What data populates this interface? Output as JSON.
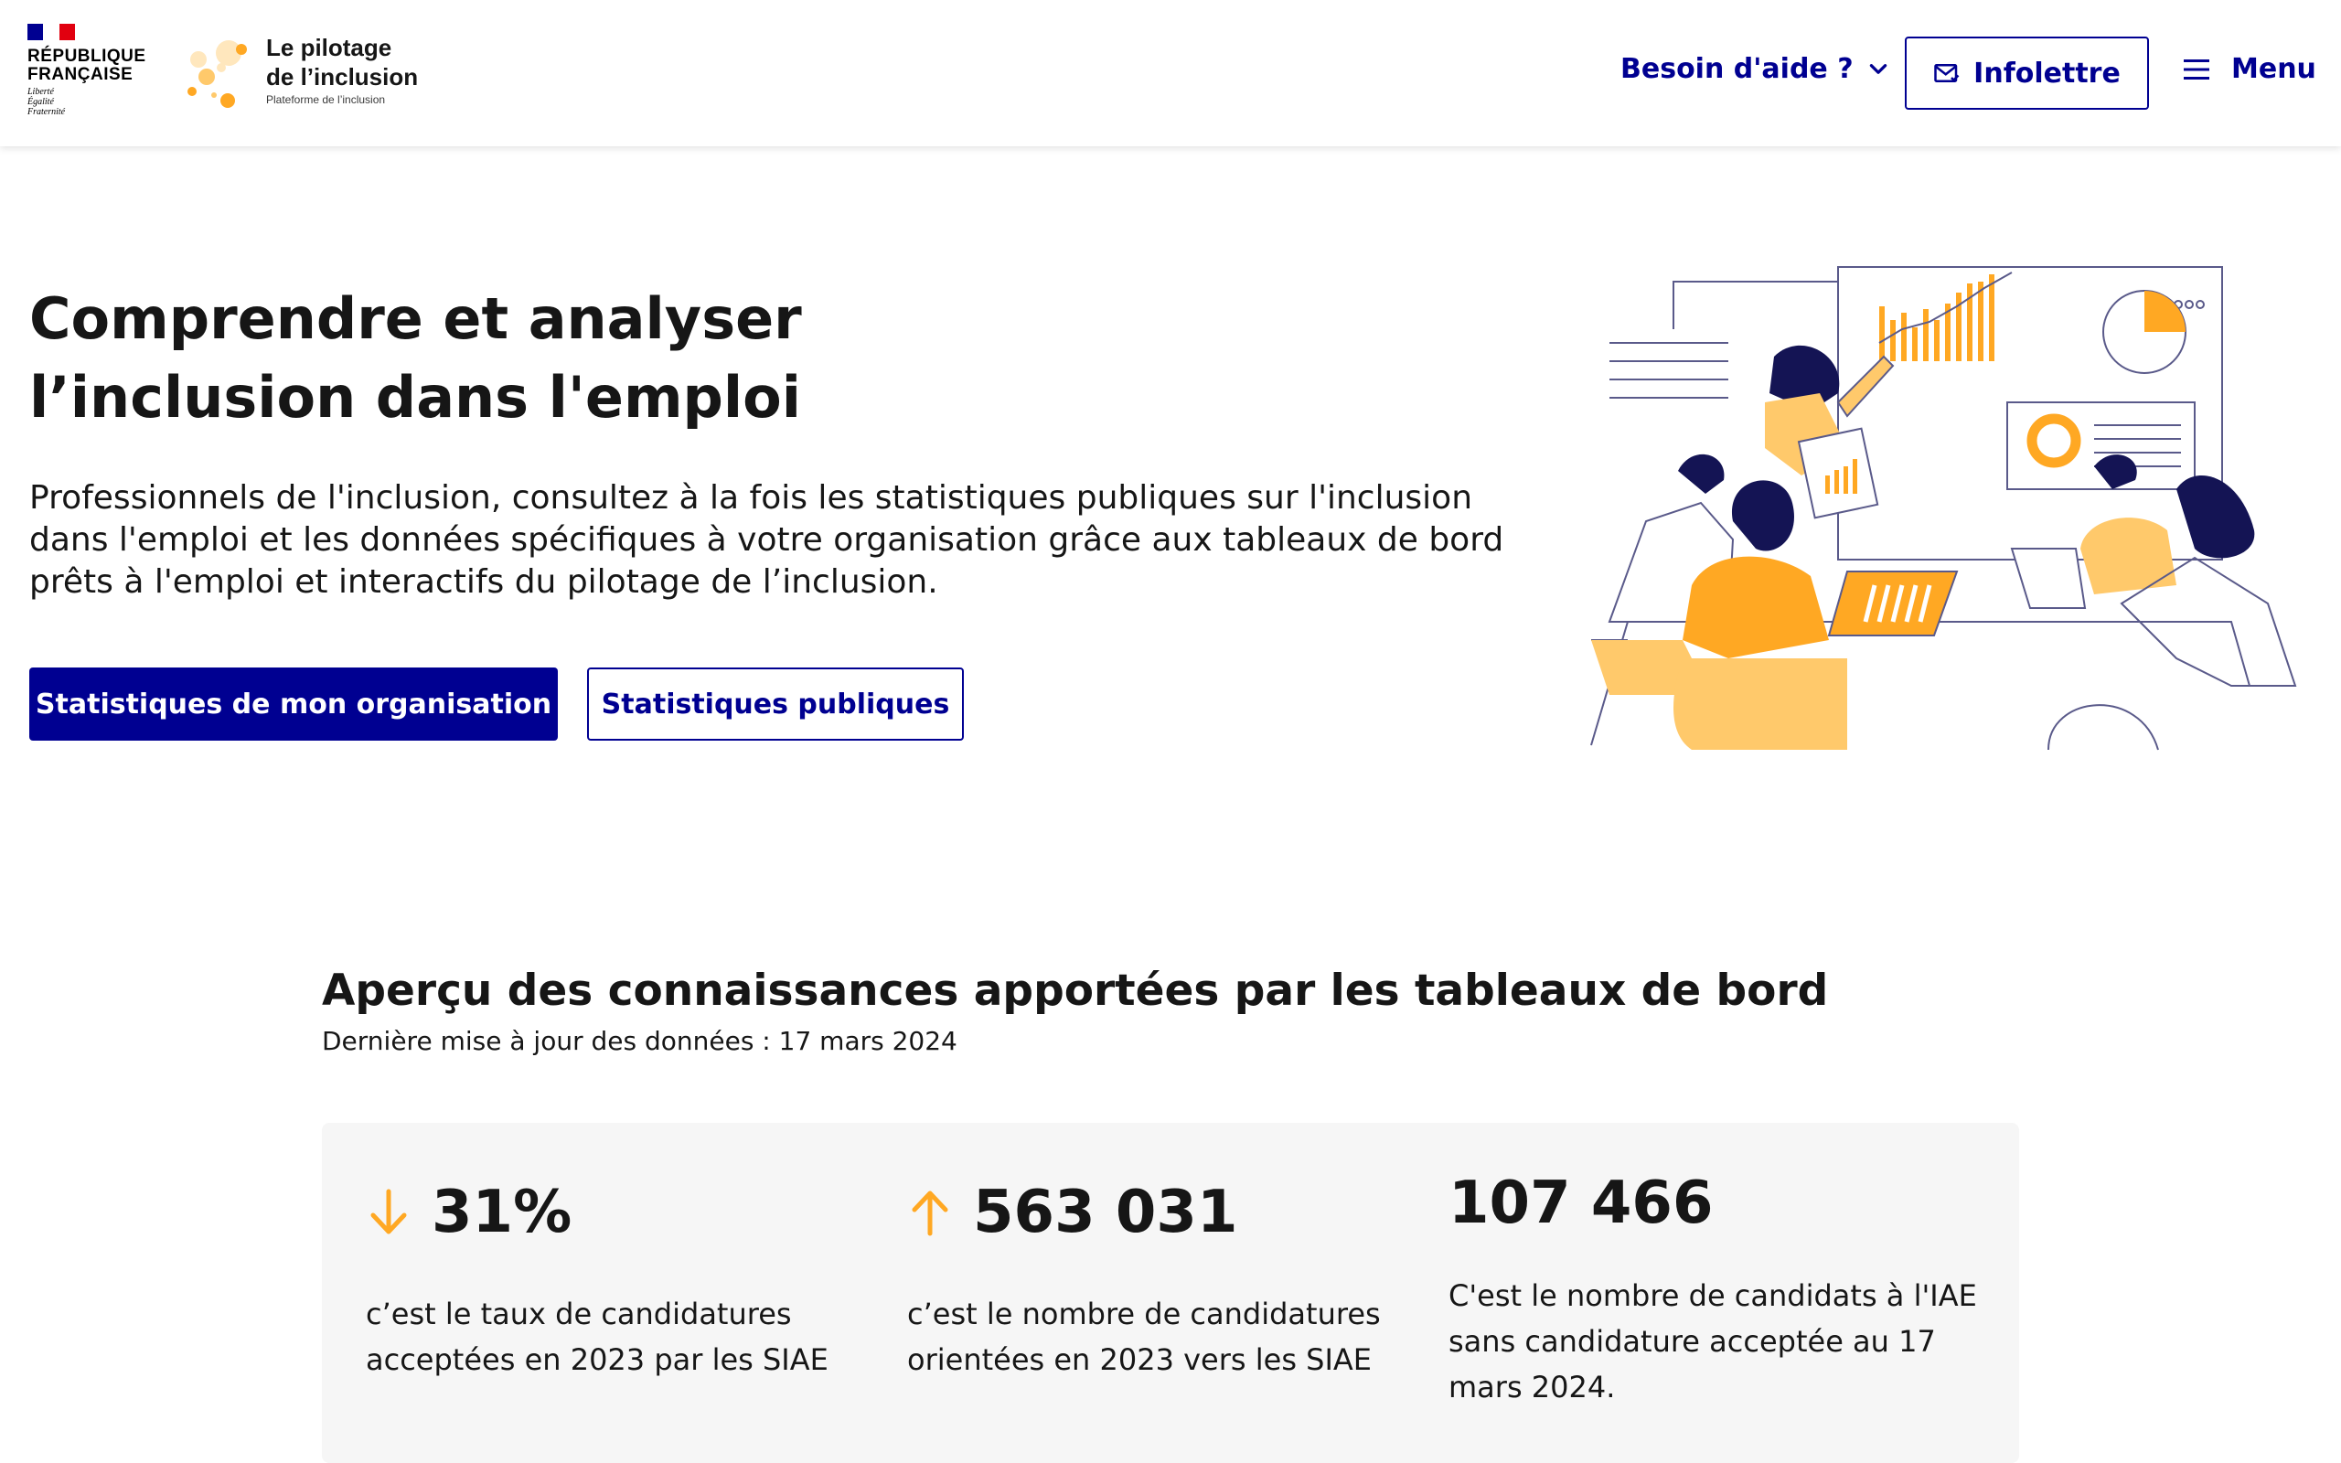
{
  "header": {
    "republic_title_line1": "RÉPUBLIQUE",
    "republic_title_line2": "FRANÇAISE",
    "motto_line1": "Liberté",
    "motto_line2": "Égalité",
    "motto_line3": "Fraternité",
    "brand_name_line1": "Le pilotage",
    "brand_name_line2": "de l’inclusion",
    "brand_tagline": "Plateforme de l’inclusion",
    "help_label": "Besoin d'aide ?",
    "newsletter_label": "Infolettre",
    "menu_label": "Menu"
  },
  "hero": {
    "title_line1": "Comprendre et analyser",
    "title_line2": "l’inclusion dans l'emploi",
    "lead": "Professionnels de l'inclusion, consultez à la fois les statistiques publiques sur l'inclusion dans l'emploi et les données spécifiques à votre organisation grâce aux tableaux de bord prêts à l'emploi et interactifs du pilotage de l’inclusion.",
    "primary_button": "Statistiques de mon organisation",
    "secondary_button": "Statistiques publiques"
  },
  "insights": {
    "title": "Aperçu des connaissances apportées par les tableaux de bord",
    "updated": "Dernière mise à jour des données : 17 mars 2024",
    "kpis": [
      {
        "value": "31%",
        "trend": "down",
        "description": "c’est le taux de candidatures acceptées en 2023 par les SIAE"
      },
      {
        "value": "563 031",
        "trend": "up",
        "description": "c’est le nombre de candidatures orientées en 2023 vers les SIAE"
      },
      {
        "value": "107 466",
        "trend": "none",
        "description": "C'est le nombre de candidats à l'IAE sans candidature acceptée au 17 mars 2024."
      }
    ]
  },
  "colors": {
    "primary_blue": "#000091",
    "accent_orange": "#ffa823",
    "flag_blue": "#000091",
    "flag_red": "#e1000f",
    "panel_grey": "#f6f6f6",
    "illustration_navy": "#141454",
    "illustration_yellow": "#ffc96b"
  },
  "icons": {
    "help_chevron": "chevron-down-icon",
    "newsletter": "mail-icon",
    "menu": "hamburger-icon",
    "trend_down": "arrow-down-icon",
    "trend_up": "arrow-up-icon"
  }
}
